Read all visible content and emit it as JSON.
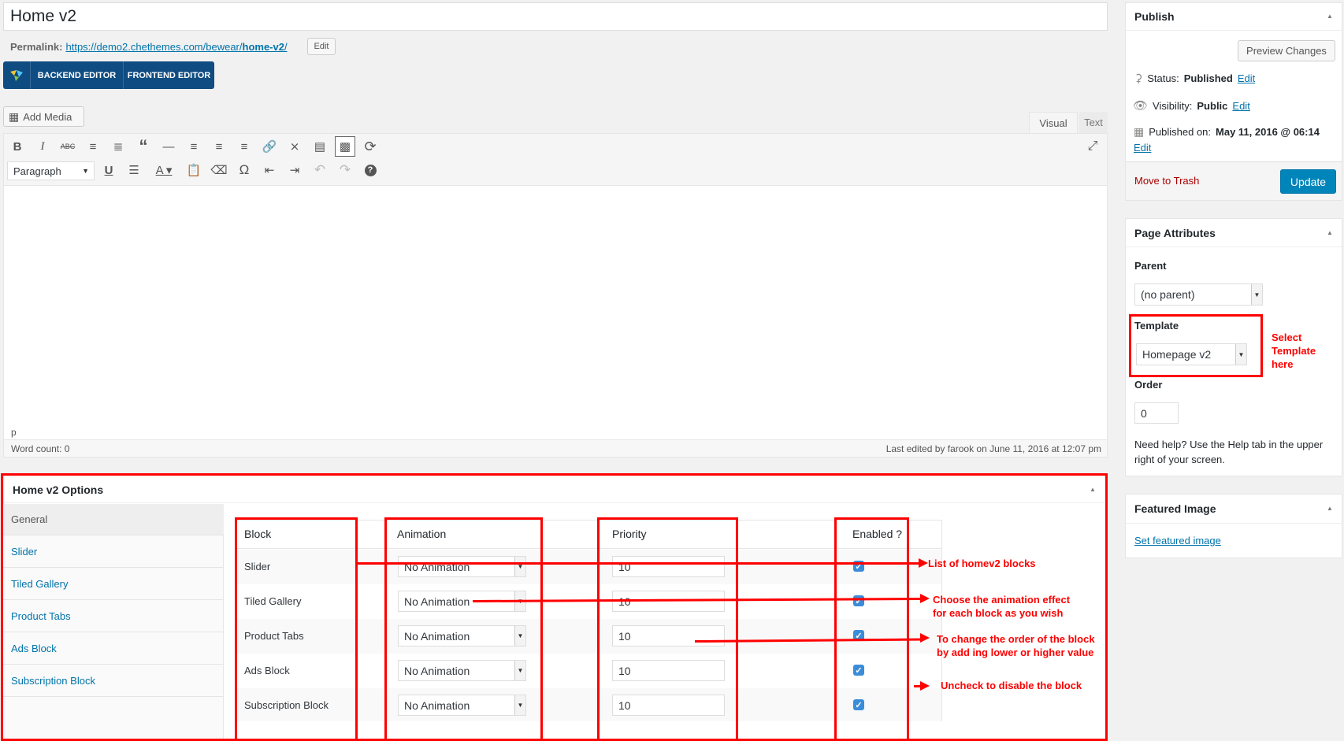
{
  "post": {
    "title": "Home v2",
    "permalink_label": "Permalink:",
    "permalink_base": "https://demo2.chethemes.com/bewear/",
    "permalink_slug": "home-v2",
    "permalink_trailing": "/",
    "permalink_edit": "Edit"
  },
  "composer": {
    "backend_label": "BACKEND EDITOR",
    "frontend_label": "FRONTEND EDITOR"
  },
  "editor": {
    "add_media": "Add Media",
    "tab_visual": "Visual",
    "tab_text": "Text",
    "format_select": "Paragraph",
    "path": "p",
    "word_count": "Word count: 0",
    "last_edited": "Last edited by farook on June 11, 2016 at 12:07 pm"
  },
  "publish": {
    "title": "Publish",
    "preview_button": "Preview Changes",
    "status_label": "Status:",
    "status_value": "Published",
    "visibility_label": "Visibility:",
    "visibility_value": "Public",
    "published_label": "Published on:",
    "published_value": "May 11, 2016 @ 06:14",
    "edit": "Edit",
    "trash": "Move to Trash",
    "update": "Update"
  },
  "attributes": {
    "title": "Page Attributes",
    "parent_label": "Parent",
    "parent_value": "(no parent)",
    "template_label": "Template",
    "template_value": "Homepage v2",
    "order_label": "Order",
    "order_value": "0",
    "help": "Need help? Use the Help tab in the upper right of your screen."
  },
  "featured": {
    "title": "Featured Image",
    "link": "Set featured image"
  },
  "options": {
    "title": "Home v2 Options",
    "tabs": [
      "General",
      "Slider",
      "Tiled Gallery",
      "Product Tabs",
      "Ads Block",
      "Subscription Block"
    ],
    "headers": {
      "block": "Block",
      "animation": "Animation",
      "priority": "Priority",
      "enabled": "Enabled ?"
    },
    "rows": [
      {
        "block": "Slider",
        "animation": "No Animation",
        "priority": "10",
        "enabled": true
      },
      {
        "block": "Tiled Gallery",
        "animation": "No Animation",
        "priority": "10",
        "enabled": true
      },
      {
        "block": "Product Tabs",
        "animation": "No Animation",
        "priority": "10",
        "enabled": true
      },
      {
        "block": "Ads Block",
        "animation": "No Animation",
        "priority": "10",
        "enabled": true
      },
      {
        "block": "Subscription Block",
        "animation": "No Animation",
        "priority": "10",
        "enabled": true
      }
    ]
  },
  "annotations": {
    "select_template_1": "Select",
    "select_template_2": "Template",
    "select_template_3": "here",
    "list_blocks": "List of homev2 blocks",
    "animation_1": "Choose the animation effect",
    "animation_2": "for each block as you wish",
    "order_1": "To change the order of the block",
    "order_2": "by add ing lower or higher value",
    "uncheck": "Uncheck to disable the block"
  },
  "colors": {
    "primary": "#0085ba",
    "composer": "#0f4c81",
    "annotation": "#ff0000",
    "link": "#0073aa",
    "trash": "#a00"
  }
}
